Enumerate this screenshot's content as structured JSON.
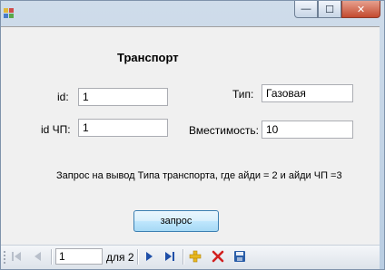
{
  "window": {
    "title": "",
    "controls": {
      "minimize": "—",
      "maximize": "☐",
      "close": "✕"
    }
  },
  "form": {
    "title": "Транспорт",
    "fields": {
      "id": {
        "label": "id:",
        "value": "1"
      },
      "id_chp": {
        "label": "id ЧП:",
        "value": "1"
      },
      "type": {
        "label": "Тип:",
        "value": "Газовая"
      },
      "capacity": {
        "label": "Вместимость:",
        "value": "10"
      }
    },
    "query_description": "Запрос на вывод Типа  транспорта, где айди = 2 и айди ЧП =3",
    "query_button": "запрос"
  },
  "navigator": {
    "position": "1",
    "count_text": "для 2"
  },
  "colors": {
    "accent_blue": "#3c7fb1",
    "add_icon": "#e8b820",
    "delete_icon": "#d22020",
    "save_icon": "#2a5ea8"
  }
}
